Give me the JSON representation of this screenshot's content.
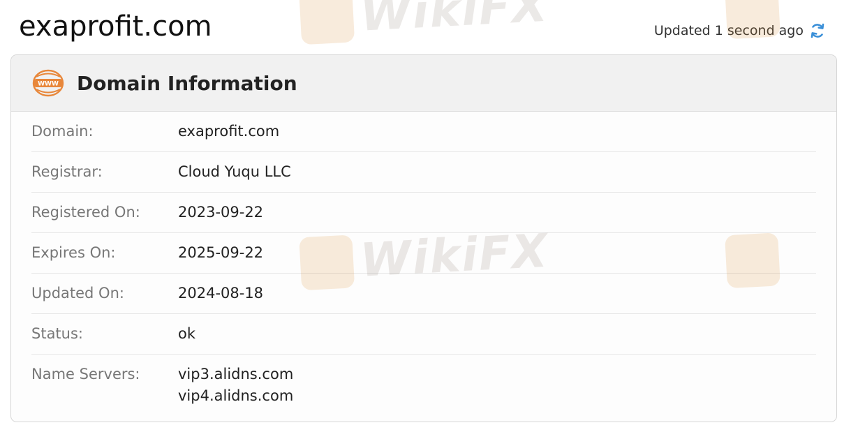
{
  "header": {
    "site_title": "exaprofit.com",
    "updated_text": "Updated 1 second ago"
  },
  "card": {
    "title": "Domain Information",
    "icon": "www-globe-icon",
    "rows": [
      {
        "label": "Domain:",
        "value": "exaprofit.com"
      },
      {
        "label": "Registrar:",
        "value": "Cloud Yuqu LLC"
      },
      {
        "label": "Registered On:",
        "value": "2023-09-22"
      },
      {
        "label": "Expires On:",
        "value": "2025-09-22"
      },
      {
        "label": "Updated On:",
        "value": "2024-08-18"
      },
      {
        "label": "Status:",
        "value": "ok"
      }
    ],
    "name_servers": {
      "label": "Name Servers:",
      "values": [
        "vip3.alidns.com",
        "vip4.alidns.com"
      ]
    }
  },
  "watermark": {
    "text": "WikiFX"
  },
  "colors": {
    "accent_orange": "#e8873a",
    "refresh_blue": "#3a8fd8",
    "header_bg": "#f1f1f1"
  }
}
